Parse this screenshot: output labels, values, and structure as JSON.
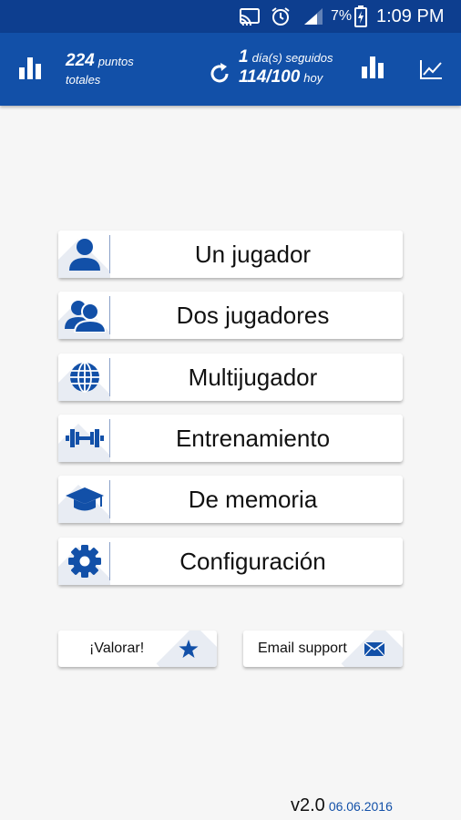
{
  "status_bar": {
    "battery_percent": "7%",
    "time": "1:09 PM",
    "icons": [
      "cast-icon",
      "alarm-icon",
      "signal-icon",
      "battery-charging-icon"
    ]
  },
  "app_bar": {
    "points_value": "224",
    "points_unit": "puntos",
    "points_sub": "totales",
    "streak_value": "1",
    "streak_unit": "día(s) seguidos",
    "today_value": "114/100",
    "today_unit": "hoy",
    "icons": [
      "bar-chart-icon",
      "refresh-icon",
      "bar-chart-icon",
      "line-chart-icon"
    ]
  },
  "menu": [
    {
      "label": "Un jugador",
      "icon": "single-player-icon"
    },
    {
      "label": "Dos jugadores",
      "icon": "two-players-icon"
    },
    {
      "label": "Multijugador",
      "icon": "globe-icon"
    },
    {
      "label": "Entrenamiento",
      "icon": "dumbbell-icon"
    },
    {
      "label": "De memoria",
      "icon": "graduation-cap-icon"
    },
    {
      "label": "Configuración",
      "icon": "gear-icon"
    }
  ],
  "actions": {
    "rate_label": "¡Valorar!",
    "email_label": "Email support"
  },
  "footer": {
    "version": "v2.0",
    "date": "06.06.2016"
  },
  "colors": {
    "status_bar": "#0d3e8f",
    "app_bar": "#1250a8",
    "accent": "#1250a8",
    "background": "#f6f6f6"
  }
}
